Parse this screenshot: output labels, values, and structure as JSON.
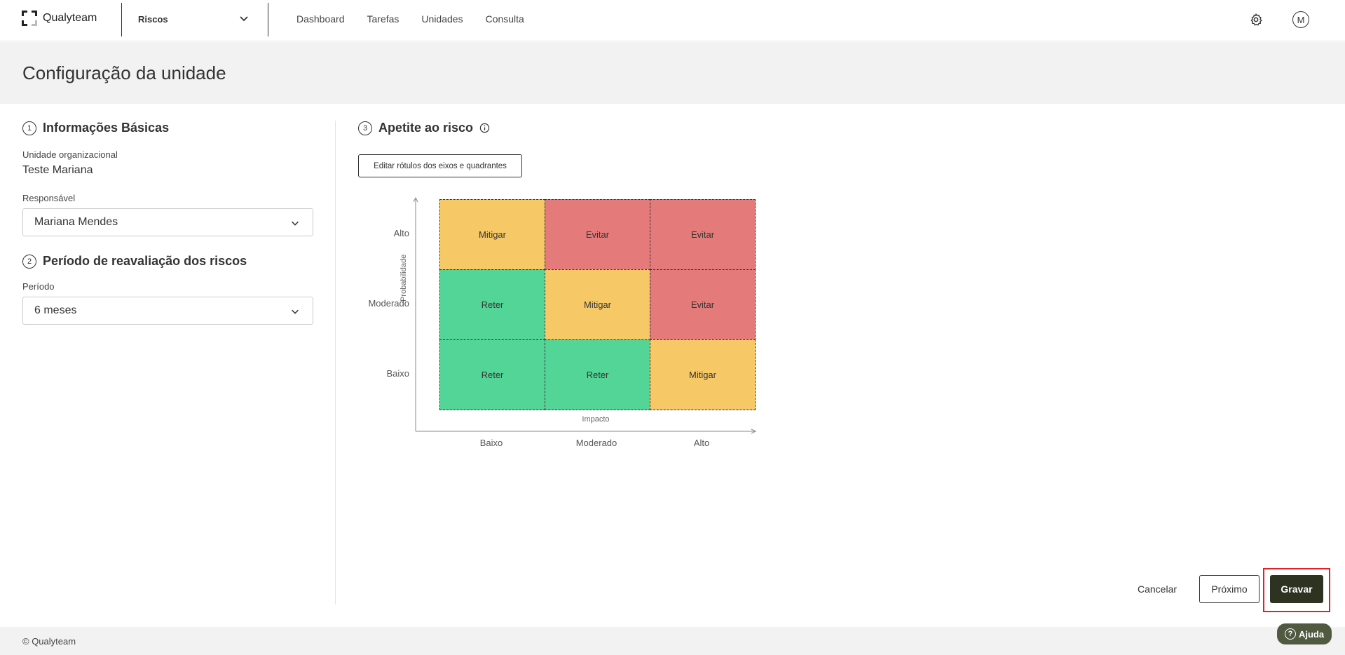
{
  "header": {
    "brand": "Qualyteam",
    "module": "Riscos",
    "nav": [
      "Dashboard",
      "Tarefas",
      "Unidades",
      "Consulta"
    ],
    "user_initial": "M"
  },
  "page": {
    "title": "Configuração da unidade"
  },
  "basic_info": {
    "step": "1",
    "title": "Informações Básicas",
    "org_unit_label": "Unidade organizacional",
    "org_unit_value": "Teste Mariana",
    "responsible_label": "Responsável",
    "responsible_value": "Mariana Mendes"
  },
  "reassessment": {
    "step": "2",
    "title": "Período de reavaliação dos riscos",
    "period_label": "Período",
    "period_value": "6 meses"
  },
  "appetite": {
    "step": "3",
    "title": "Apetite ao risco",
    "edit_button": "Editar rótulos dos eixos e quadrantes",
    "y_axis_title": "Probabilidade",
    "x_axis_title": "Impacto",
    "y_labels": [
      "Alto",
      "Moderado",
      "Baixo"
    ],
    "x_labels": [
      "Baixo",
      "Moderado",
      "Alto"
    ],
    "cells": [
      [
        "Mitigar",
        "Evitar",
        "Evitar"
      ],
      [
        "Reter",
        "Mitigar",
        "Evitar"
      ],
      [
        "Reter",
        "Reter",
        "Mitigar"
      ]
    ],
    "colors": {
      "Mitigar": "#f6c866",
      "Evitar": "#e47a7a",
      "Reter": "#54d598"
    }
  },
  "actions": {
    "cancel": "Cancelar",
    "next": "Próximo",
    "save": "Gravar"
  },
  "footer": {
    "copyright": "© Qualyteam",
    "help": "Ajuda"
  }
}
